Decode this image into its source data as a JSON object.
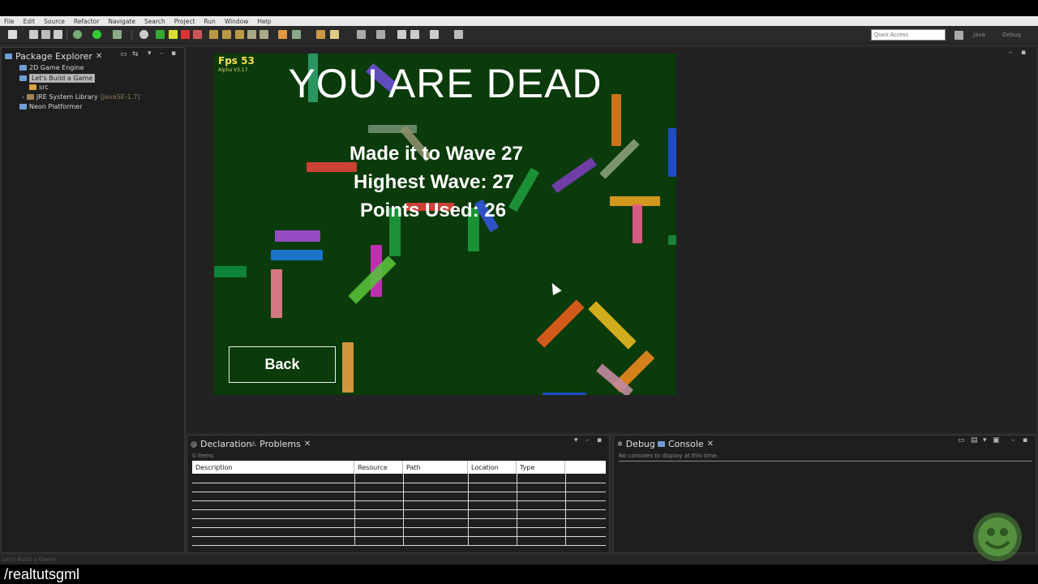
{
  "menubar": {
    "items": [
      "File",
      "Edit",
      "Source",
      "Refactor",
      "Navigate",
      "Search",
      "Project",
      "Run",
      "Window",
      "Help"
    ]
  },
  "toolbar": {
    "quick_access_placeholder": "Quick Access",
    "perspective_java": "Java",
    "perspective_debug": "Debug"
  },
  "package_explorer": {
    "title": "Package Explorer",
    "projects": [
      {
        "label": "2D Game Engine"
      },
      {
        "label": "Let's Build a Game",
        "selected": true
      },
      {
        "label": "src"
      },
      {
        "label": "JRE System Library",
        "detail": "[JavaSE-1.7]"
      },
      {
        "label": "Neon Platformer"
      }
    ]
  },
  "game": {
    "fps": "Fps 53",
    "version": "Alpha V3.17",
    "headline": "YOU ARE DEAD",
    "stats": [
      "Made it to Wave 27",
      "Highest Wave: 27",
      "Points Used: 26"
    ],
    "back_label": "Back"
  },
  "problems_view": {
    "tab_declaration": "Declaration",
    "tab_problems": "Problems",
    "item_count": "0 items",
    "columns": [
      "Description",
      "Resource",
      "Path",
      "Location",
      "Type"
    ]
  },
  "console_view": {
    "tab_debug": "Debug",
    "tab_console": "Console",
    "empty_message": "No consoles to display at this time."
  },
  "status_bar": {
    "text": "Let's Build a Game"
  },
  "watermark": {
    "text": "/realtutsgml"
  },
  "colors": {
    "game_bg": "#0b3a0b",
    "fps_text": "#f2e14c",
    "ide_bg": "#2b2b2b"
  }
}
